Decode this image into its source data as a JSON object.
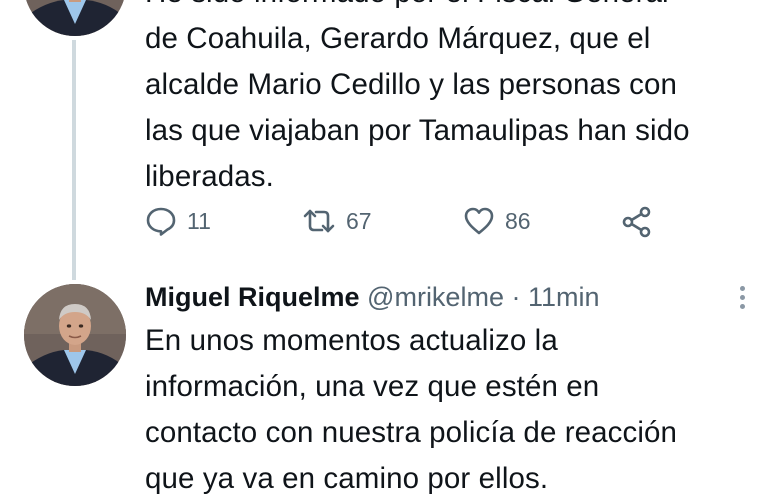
{
  "thread": {
    "tweet1": {
      "partial_first_line": "He sido informado por el Fiscal General",
      "text": "He sido informado por el Fiscal General\nde Coahuila, Gerardo Márquez, que el\nalcalde Mario Cedillo y las personas con\nlas que viajaban por Tamaulipas han sido\nliberadas.",
      "actions": {
        "reply_count": "11",
        "retweet_count": "67",
        "like_count": "86"
      }
    },
    "tweet2": {
      "author_name": "Miguel Riquelme",
      "author_handle": "@mrikelme",
      "separator": "·",
      "timestamp": "11min",
      "text": "En unos momentos actualizo la\ninformación, una vez que estén en\ncontacto con nuestra policía de reacción\nque ya va en camino por ellos."
    }
  },
  "icons": {
    "reply": "reply-icon",
    "retweet": "retweet-icon",
    "like": "heart-icon",
    "share": "share-icon",
    "more": "more-vertical-icon"
  },
  "colors": {
    "text_primary": "#0f1419",
    "text_secondary": "#536471",
    "thread_line": "#cfd9de"
  }
}
